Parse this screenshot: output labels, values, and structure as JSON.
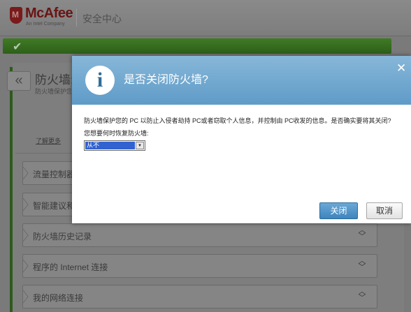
{
  "app": {
    "brand": "McAfee",
    "brand_sub": "An Intel Company",
    "window_title": "安全中心"
  },
  "panel": {
    "title": "防火墙:",
    "description": "防火墙保护您",
    "learn_more": "了解更多"
  },
  "sections": [
    {
      "label": "流量控制器"
    },
    {
      "label": "智能建议和"
    },
    {
      "label": "防火墙历史记录"
    },
    {
      "label": "程序的 Internet 连接"
    },
    {
      "label": "我的网络连接"
    }
  ],
  "dialog": {
    "title": "是否关闭防火墙?",
    "message": "防火墙保护您的 PC 以防止入侵者劫持 PC或者窃取个人信息，并控制由 PC收发的信息。是否确实要将其关闭?",
    "question": "您想要何时恢复防火墙:",
    "resume_select": {
      "selected": "从不"
    },
    "ok_label": "关闭",
    "cancel_label": "取消"
  },
  "icons": {
    "status": "checkmark-icon",
    "back": "double-chevron-left-icon",
    "info": "info-icon",
    "close": "close-icon",
    "expand": "chevron-up-down-icon"
  },
  "colors": {
    "status_green": "#2e5f1a",
    "dialog_header": "#5f9bc8",
    "primary_button": "#3e84bd",
    "select_highlight": "#3162cf"
  }
}
